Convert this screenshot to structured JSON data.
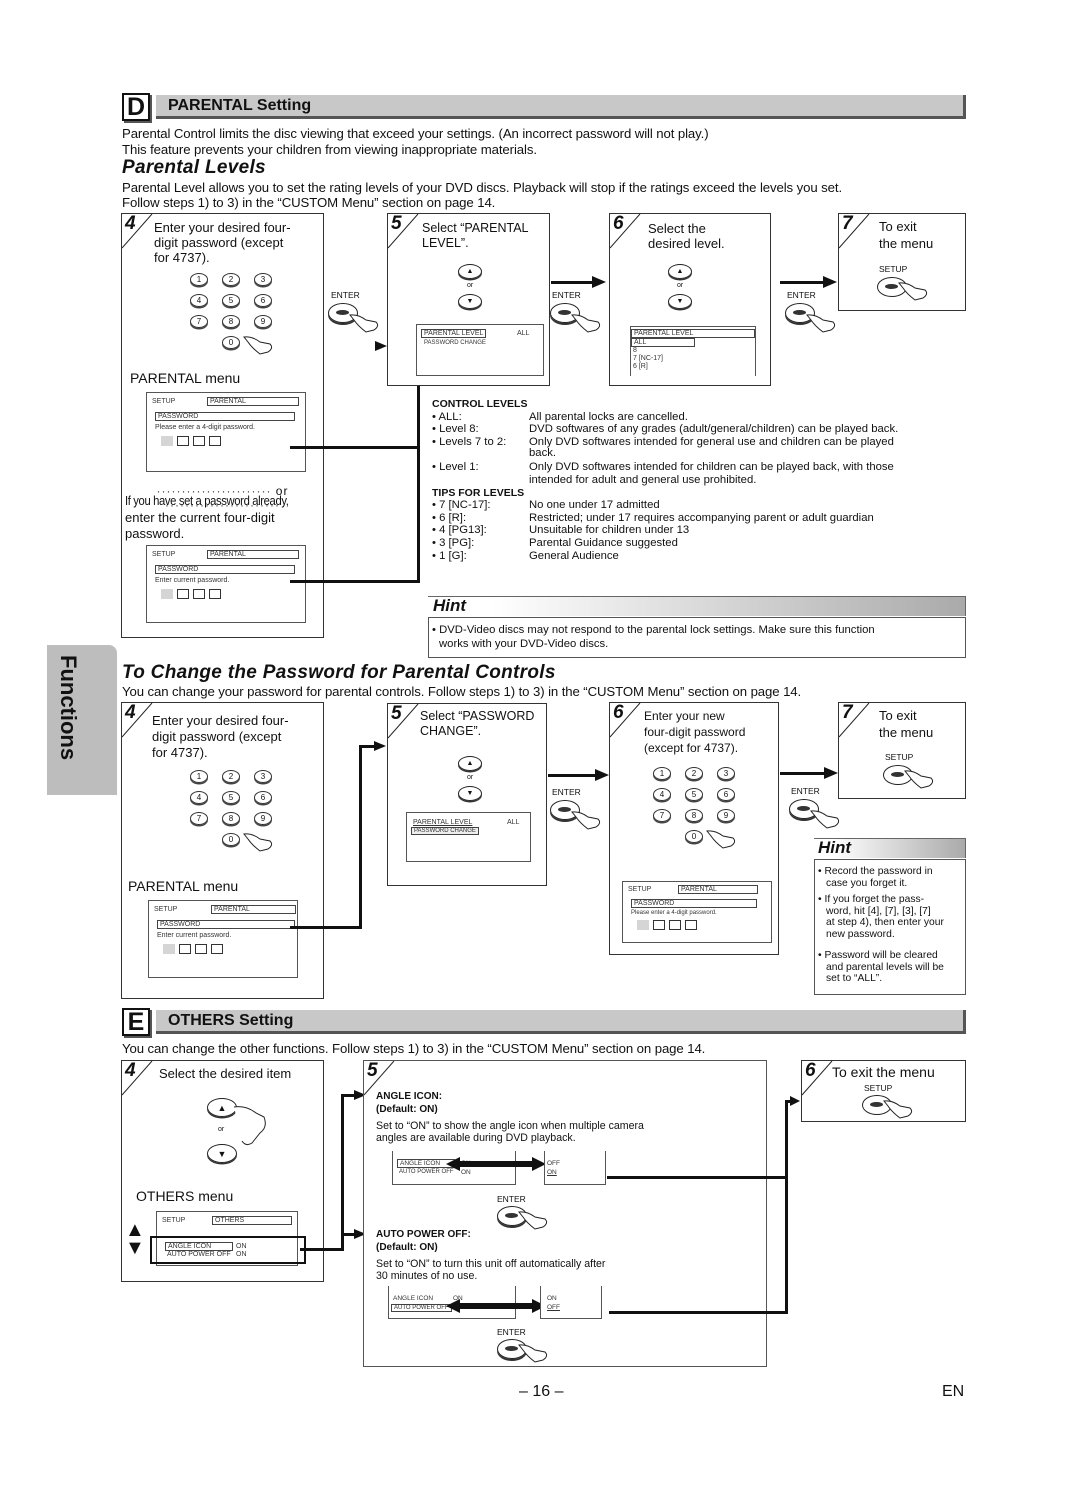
{
  "side_tab": "Functions",
  "sectionD": {
    "letter": "D",
    "title": "PARENTAL Setting",
    "intro": [
      "Parental Control limits the disc viewing that exceed your settings. (An incorrect password will not play.)",
      "This feature prevents your children from viewing inappropriate materials."
    ],
    "parental_levels": {
      "heading": "Parental Levels",
      "intro": [
        "Parental Level allows you to set the rating levels of your DVD discs. Playback will stop if the ratings exceed the levels you set.",
        "Follow steps 1) to 3) in the “CUSTOM Menu” section on page 14."
      ],
      "step4": {
        "num": "4",
        "text": [
          "Enter your desired four-",
          "digit password (except",
          "for 4737)."
        ],
        "keys": [
          "1",
          "2",
          "3",
          "4",
          "5",
          "6",
          "7",
          "8",
          "9",
          "0"
        ],
        "menu_label": "PARENTAL menu",
        "screen1": {
          "setup": "SETUP",
          "tab": "PARENTAL",
          "title": "PASSWORD",
          "prompt": "Please enter a 4-digit password."
        },
        "or": "or",
        "alt_text": [
          "If you have set a password already,",
          "enter the current four-digit",
          "password."
        ],
        "screen2": {
          "setup": "SETUP",
          "tab": "PARENTAL",
          "title": "PASSWORD",
          "prompt": "Enter current password."
        }
      },
      "step5": {
        "num": "5",
        "text": [
          "Select “PARENTAL",
          "LEVEL”."
        ],
        "or": "or",
        "enter_label": "ENTER",
        "screen": {
          "item1": "PARENTAL LEVEL",
          "item1_value": "ALL",
          "item2": "PASSWORD CHANGE"
        }
      },
      "step6": {
        "num": "6",
        "text": [
          "Select the",
          "desired level."
        ],
        "or": "or",
        "enter_label": "ENTER",
        "screen": {
          "title": "PARENTAL LEVEL",
          "options": [
            "ALL",
            "8",
            "7 [NC-17]",
            "6 [R]"
          ]
        }
      },
      "step7": {
        "num": "7",
        "text": [
          "To exit",
          "the menu"
        ],
        "enter_label": "ENTER",
        "setup_label": "SETUP"
      },
      "control_levels": {
        "heading": "CONTROL LEVELS",
        "items": [
          {
            "key": "• ALL:",
            "desc": [
              "All parental locks are cancelled."
            ]
          },
          {
            "key": "• Level 8:",
            "desc": [
              "DVD softwares of any grades (adult/general/children) can be played back."
            ]
          },
          {
            "key": "• Levels 7 to 2:",
            "desc": [
              "Only DVD softwares intended for general use and children can be played",
              "back."
            ]
          },
          {
            "key": "• Level 1:",
            "desc": [
              "Only DVD softwares intended for children can be played back, with those",
              "intended for adult and general use prohibited."
            ]
          }
        ]
      },
      "tips_for_levels": {
        "heading": "TIPS FOR LEVELS",
        "items": [
          {
            "key": "• 7 [NC-17]:",
            "desc": "No one under 17 admitted"
          },
          {
            "key": "• 6 [R]:",
            "desc": "Restricted; under 17 requires accompanying parent or adult guardian"
          },
          {
            "key": "• 4 [PG13]:",
            "desc": "Unsuitable for children under 13"
          },
          {
            "key": "• 3 [PG]:",
            "desc": "Parental Guidance suggested"
          },
          {
            "key": "• 1 [G]:",
            "desc": "General Audience"
          }
        ]
      },
      "hint": {
        "title": "Hint",
        "lines": [
          "• DVD-Video discs may not respond to the parental lock settings. Make sure this function",
          "works with your DVD-Video discs."
        ]
      }
    },
    "change_password": {
      "heading": "To Change the Password for Parental Controls",
      "intro": "You can change your password for parental controls.  Follow steps 1) to 3) in the “CUSTOM Menu” section on page 14.",
      "step4": {
        "num": "4",
        "text": [
          "Enter your desired four-",
          "digit password (except",
          "for 4737)."
        ],
        "menu_label": "PARENTAL menu",
        "screen": {
          "setup": "SETUP",
          "tab": "PARENTAL",
          "title": "PASSWORD",
          "prompt": "Enter current password."
        }
      },
      "step5": {
        "num": "5",
        "text": [
          "Select “PASSWORD",
          "CHANGE”."
        ],
        "or": "or",
        "screen": {
          "item1": "PARENTAL LEVEL",
          "item1_value": "ALL",
          "item2": "PASSWORD CHANGE"
        }
      },
      "step6": {
        "num": "6",
        "text": [
          "Enter your new",
          "four-digit password",
          "(except for 4737)."
        ],
        "enter_label": "ENTER",
        "screen": {
          "setup": "SETUP",
          "tab": "PARENTAL",
          "title": "PASSWORD",
          "prompt": "Please enter a 4-digit password."
        }
      },
      "step7": {
        "num": "7",
        "text": [
          "To exit",
          "the menu"
        ],
        "enter_label": "ENTER",
        "setup_label": "SETUP"
      },
      "hint": {
        "title": "Hint",
        "items": [
          [
            "Record the password in",
            "case you forget it."
          ],
          [
            "If you forget the pass-",
            "word, hit [4], [7], [3], [7]",
            "at step 4), then enter your",
            "new password."
          ],
          [
            "Password will be cleared",
            "and parental levels will be",
            "set to “ALL”."
          ]
        ]
      }
    }
  },
  "sectionE": {
    "letter": "E",
    "title": "OTHERS Setting",
    "intro": "You can change the other functions. Follow steps 1) to 3) in the “CUSTOM Menu” section on page 14.",
    "step4": {
      "num": "4",
      "text": "Select the desired item",
      "or": "or",
      "menu_label": "OTHERS menu",
      "screen": {
        "setup": "SETUP",
        "tab": "OTHERS",
        "item1": "ANGLE ICON",
        "item1_value": "ON",
        "item2": "AUTO POWER OFF",
        "item2_value": "ON"
      }
    },
    "step5": {
      "num": "5",
      "angle_icon": {
        "title": "ANGLE ICON:",
        "default": "(Default: ON)",
        "desc": [
          "Set to “ON” to show the angle icon when multiple camera",
          "angles are available during DVD playback."
        ],
        "screen_left": {
          "item1": "ANGLE ICON",
          "item1_value": "ON",
          "item2": "AUTO POWER OFF",
          "item2_value": "ON"
        },
        "screen_right": {
          "v1": "OFF",
          "v2": "ON"
        },
        "enter_label": "ENTER"
      },
      "auto_power_off": {
        "title": "AUTO POWER OFF:",
        "default": "(Default: ON)",
        "desc": [
          "Set to “ON” to turn this unit off automatically after",
          "30 minutes of no use."
        ],
        "screen_left": {
          "item1": "ANGLE ICON",
          "item1_value": "ON",
          "item2": "AUTO POWER OFF",
          "item2_value": "ON"
        },
        "screen_right": {
          "v1": "ON",
          "v2": "OFF"
        },
        "enter_label": "ENTER"
      }
    },
    "step6": {
      "num": "6",
      "text": "To exit the menu",
      "setup_label": "SETUP"
    }
  },
  "footer": {
    "page_number": "– 16 –",
    "language": "EN"
  }
}
